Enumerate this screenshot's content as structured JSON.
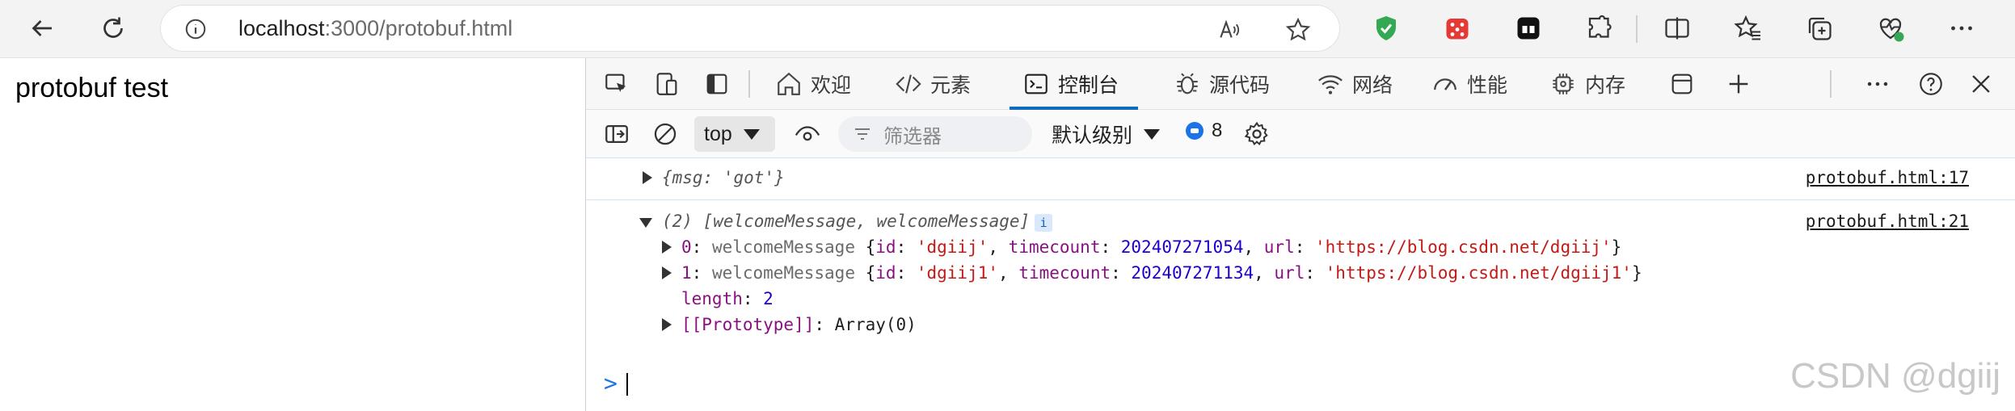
{
  "browser": {
    "address": {
      "host": "localhost",
      "rest": ":3000/protobuf.html"
    }
  },
  "page": {
    "heading": "protobuf test"
  },
  "devtools": {
    "tabs": [
      {
        "label": "欢迎"
      },
      {
        "label": "元素"
      },
      {
        "label": "控制台"
      },
      {
        "label": "源代码"
      },
      {
        "label": "网络"
      },
      {
        "label": "性能"
      },
      {
        "label": "内存"
      }
    ],
    "toolbar": {
      "context": "top",
      "filter_placeholder": "筛选器",
      "level": "默认级别",
      "issues_count": "8"
    },
    "console": {
      "row1": {
        "text": "{msg: 'got'}",
        "source": "protobuf.html:17"
      },
      "row2": {
        "count": "(2)",
        "summary": "[welcomeMessage, welcomeMessage]",
        "info": "i",
        "source": "protobuf.html:21",
        "items": [
          {
            "index": "0",
            "cls": "welcomeMessage",
            "id": "'dgiij'",
            "timecount": "202407271054",
            "url": "'https://blog.csdn.net/dgiij'"
          },
          {
            "index": "1",
            "cls": "welcomeMessage",
            "id": "'dgiij1'",
            "timecount": "202407271134",
            "url": "'https://blog.csdn.net/dgiij1'"
          }
        ],
        "length_key": "length",
        "length_value": "2",
        "proto_key": "[[Prototype]]",
        "proto_value": "Array(0)"
      },
      "prompt": ">"
    }
  },
  "watermark": "CSDN @dgiij"
}
